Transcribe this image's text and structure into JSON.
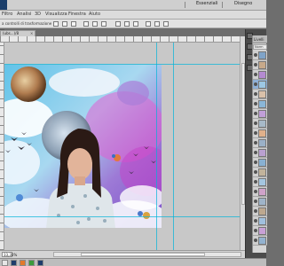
{
  "titlebar": {
    "app_icon": "photoshop-logo",
    "workspace_essentials": "Essenziali",
    "workspace_design": "Disegno"
  },
  "menu": {
    "items": [
      {
        "label": "Filtro"
      },
      {
        "label": "Analisi"
      },
      {
        "label": "3D"
      },
      {
        "label": "Visualizza"
      },
      {
        "label": "Finestra"
      },
      {
        "label": "Aiuto"
      }
    ]
  },
  "options": {
    "label": "a controlli di trasformazione"
  },
  "document": {
    "tab_label": "(ubs...)/8",
    "tab_close": "×"
  },
  "status": {
    "zoom": "33,33%"
  },
  "layers": {
    "header": "Livelli",
    "mode": "Norm",
    "rows": [
      {
        "icon": "eye-icon"
      },
      {
        "icon": "eye-icon"
      },
      {
        "icon": "eye-icon"
      },
      {
        "icon": "eye-icon"
      },
      {
        "icon": "eye-icon"
      },
      {
        "icon": "eye-icon"
      },
      {
        "icon": "eye-icon"
      },
      {
        "icon": "eye-icon"
      },
      {
        "icon": "eye-icon"
      },
      {
        "icon": "eye-icon"
      },
      {
        "icon": "eye-icon"
      },
      {
        "icon": "eye-icon"
      },
      {
        "icon": "eye-icon"
      },
      {
        "icon": "eye-icon"
      },
      {
        "icon": "eye-icon"
      },
      {
        "icon": "eye-icon"
      },
      {
        "icon": "eye-icon"
      },
      {
        "icon": "eye-icon"
      },
      {
        "icon": "eye-icon"
      },
      {
        "icon": "eye-icon"
      }
    ]
  },
  "colors": {
    "guide": "#00b4d8",
    "active_layer": "#8fb0d6",
    "canvas_bg": "#c8c8c8"
  }
}
